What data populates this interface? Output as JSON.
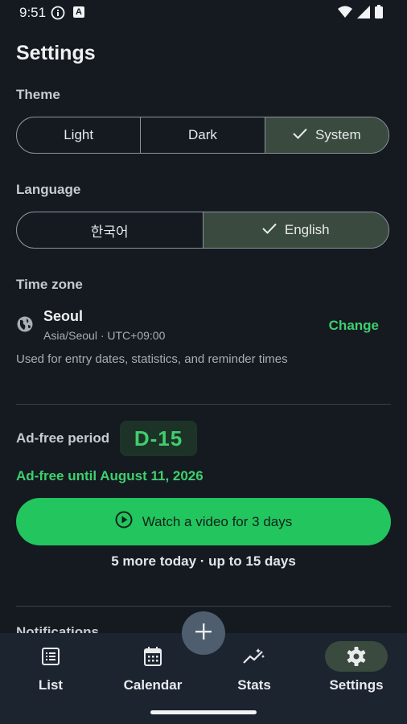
{
  "status": {
    "time": "9:51",
    "a_glyph": "A"
  },
  "title": "Settings",
  "theme": {
    "label": "Theme",
    "options": [
      "Light",
      "Dark",
      "System"
    ],
    "selected": "System"
  },
  "language": {
    "label": "Language",
    "options": [
      "한국어",
      "English"
    ],
    "selected": "English"
  },
  "timezone": {
    "label": "Time zone",
    "city": "Seoul",
    "detail": "Asia/Seoul · UTC+09:00",
    "change_label": "Change",
    "description": "Used for entry dates, statistics, and reminder times"
  },
  "ad": {
    "label": "Ad-free period",
    "badge": "D-15",
    "until": "Ad-free until August 11, 2026",
    "watch_label": "Watch a video for 3 days",
    "sub": "5 more today · up to 15 days"
  },
  "notifications": {
    "label": "Notifications"
  },
  "nav": {
    "items": [
      {
        "label": "List",
        "icon": "list-icon"
      },
      {
        "label": "Calendar",
        "icon": "calendar-icon"
      },
      {
        "label": "Stats",
        "icon": "stats-icon"
      },
      {
        "label": "Settings",
        "icon": "gear-icon"
      }
    ],
    "active": "Settings"
  },
  "colors": {
    "accent": "#22c55e",
    "accent_text": "#3ecf6f",
    "background": "#141a20",
    "selected": "#3a4a3e"
  }
}
